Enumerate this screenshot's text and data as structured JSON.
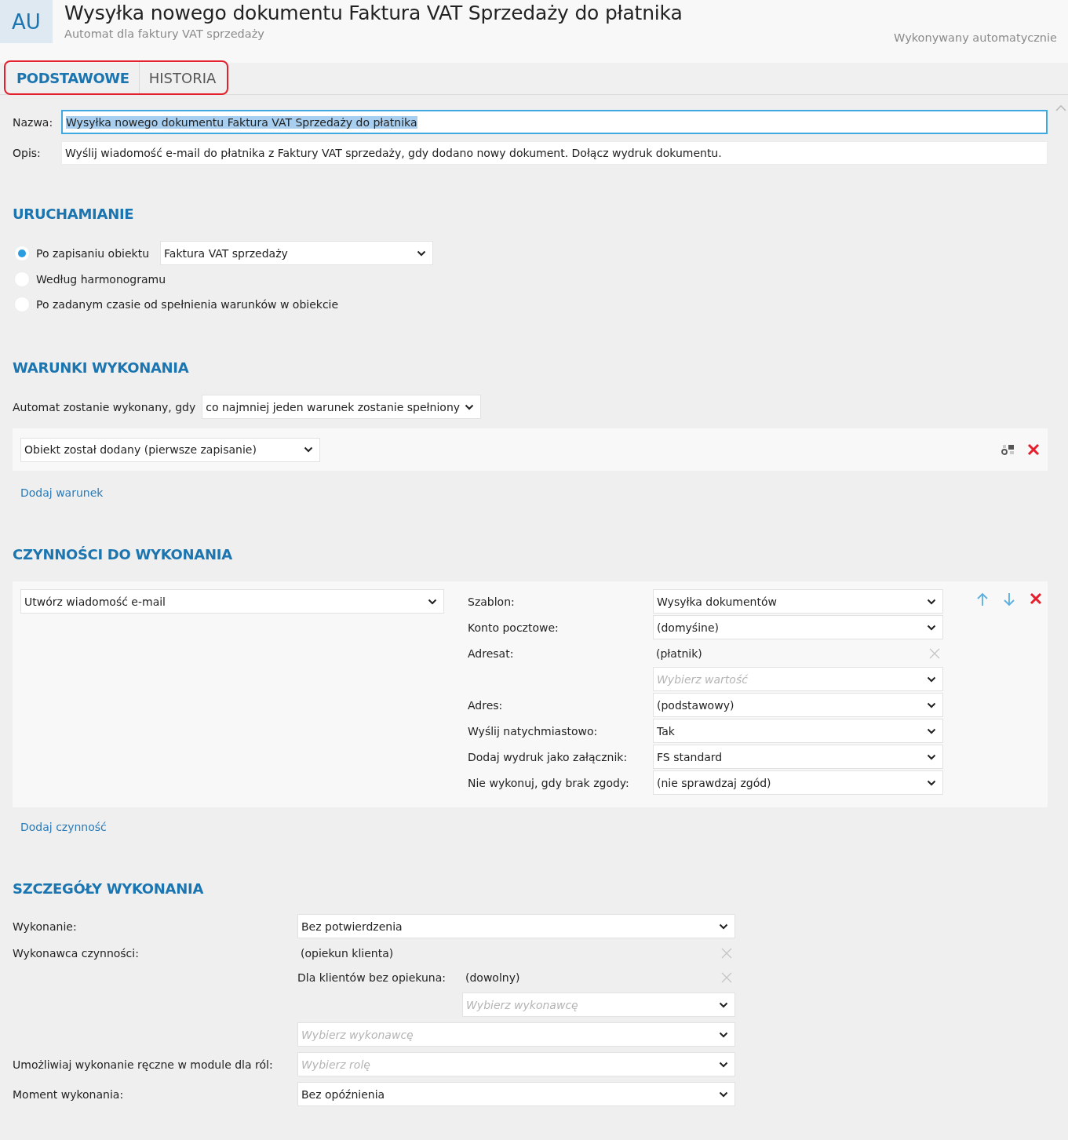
{
  "header": {
    "badge": "AU",
    "title": "Wysyłka nowego dokumentu Faktura VAT Sprzedaży do płatnika",
    "subtitle": "Automat dla faktury VAT sprzedaży",
    "status": "Wykonywany automatycznie"
  },
  "tabs": [
    {
      "label": "PODSTAWOWE",
      "selected": true
    },
    {
      "label": "HISTORIA",
      "selected": false
    }
  ],
  "general": {
    "name_label": "Nazwa:",
    "name_value": "Wysyłka nowego dokumentu Faktura VAT Sprzedaży do płatnika",
    "description_label": "Opis:",
    "description_value": "Wyślij wiadomość e-mail do płatnika z Faktury VAT sprzedaży, gdy dodano nowy dokument. Dołącz wydruk dokumentu."
  },
  "launch": {
    "heading": "URUCHAMIANIE",
    "options": [
      {
        "label": "Po zapisaniu obiektu",
        "selected": true,
        "select_value": "Faktura VAT sprzedaży"
      },
      {
        "label": "Według harmonogramu",
        "selected": false
      },
      {
        "label": "Po zadanym czasie od spełnienia warunków w obiekcie",
        "selected": false
      }
    ]
  },
  "conditions": {
    "heading": "WARUNKI WYKONANIA",
    "mode_label": "Automat zostanie wykonany, gdy",
    "mode_value": "co najmniej jeden warunek zostanie spełniony",
    "items": [
      {
        "value": "Obiekt został dodany (pierwsze zapisanie)"
      }
    ],
    "add_link": "Dodaj warunek"
  },
  "actions": {
    "heading": "CZYNNOŚCI DO WYKONANIA",
    "items": [
      {
        "type": "Utwórz wiadomość e-mail",
        "fields": [
          {
            "kind": "select",
            "label": "Szablon:",
            "value": "Wysyłka dokumentów"
          },
          {
            "kind": "select",
            "label": "Konto pocztowe:",
            "value": "(domyśine)"
          },
          {
            "kind": "token",
            "label": "Adresat:",
            "value": "(płatnik)"
          },
          {
            "kind": "select",
            "placeholder": "Wybierz wartość"
          },
          {
            "kind": "select",
            "label": "Adres:",
            "value": "(podstawowy)"
          },
          {
            "kind": "select",
            "label": "Wyślij natychmiastowo:",
            "value": "Tak"
          },
          {
            "kind": "select",
            "label": "Dodaj wydruk jako załącznik:",
            "value": "FS standard"
          },
          {
            "kind": "select",
            "label": "Nie wykonuj, gdy brak zgody:",
            "value": "(nie sprawdzaj zgód)"
          }
        ]
      }
    ],
    "add_link": "Dodaj czynność"
  },
  "details": {
    "heading": "SZCZEGÓŁY WYKONANIA",
    "rows": [
      {
        "kind": "select",
        "label": "Wykonanie:",
        "value": "Bez potwierdzenia"
      },
      {
        "kind": "token",
        "label": "Wykonawca czynności:",
        "value": "(opiekun klienta)"
      },
      {
        "kind": "sub-token",
        "label": "Dla klientów bez opiekuna:",
        "value": "(dowolny)"
      },
      {
        "kind": "sub-select",
        "placeholder": "Wybierz wykonawcę"
      },
      {
        "kind": "select",
        "placeholder": "Wybierz wykonawcę"
      },
      {
        "kind": "select",
        "label": "Umożliwiaj wykonanie ręczne w module dla ról:",
        "placeholder": "Wybierz rolę"
      },
      {
        "kind": "select",
        "label": "Moment wykonania:",
        "value": "Bez opóźnienia"
      }
    ]
  }
}
